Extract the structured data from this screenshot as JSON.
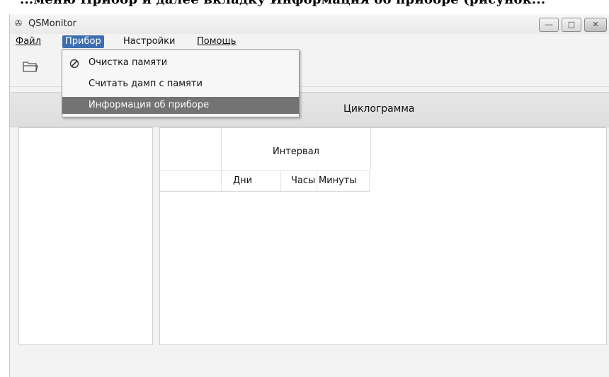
{
  "doc_caption": "...меню Прибор и далее вкладку Информация об приборе (рисунок...",
  "window": {
    "title": "QSMonitor",
    "app_icon": "device-icon",
    "controls": [
      "minimize-icon",
      "maximize-icon",
      "close-icon"
    ]
  },
  "menubar": {
    "items": [
      {
        "label": "Файл"
      },
      {
        "label": "Прибор"
      },
      {
        "label": "Настройки"
      },
      {
        "label": "Помощь"
      }
    ],
    "active": "Прибор"
  },
  "toolbar": {
    "open_icon": "folder-open-icon"
  },
  "dropdown": {
    "items": [
      {
        "label": "Очистка памяти",
        "icon": "clear-memory-icon"
      },
      {
        "label": "Считать дамп с памяти"
      },
      {
        "label": "Информация об приборе",
        "highlighted": true
      }
    ]
  },
  "main": {
    "cyclogram_title": "Циклограмма",
    "table": {
      "group_header": "Интервал",
      "columns": [
        "Дни",
        "Часы",
        "Минуты"
      ]
    }
  },
  "colors": {
    "menu_active": "#3d6fb0",
    "dropdown_highlight": "#737373"
  }
}
